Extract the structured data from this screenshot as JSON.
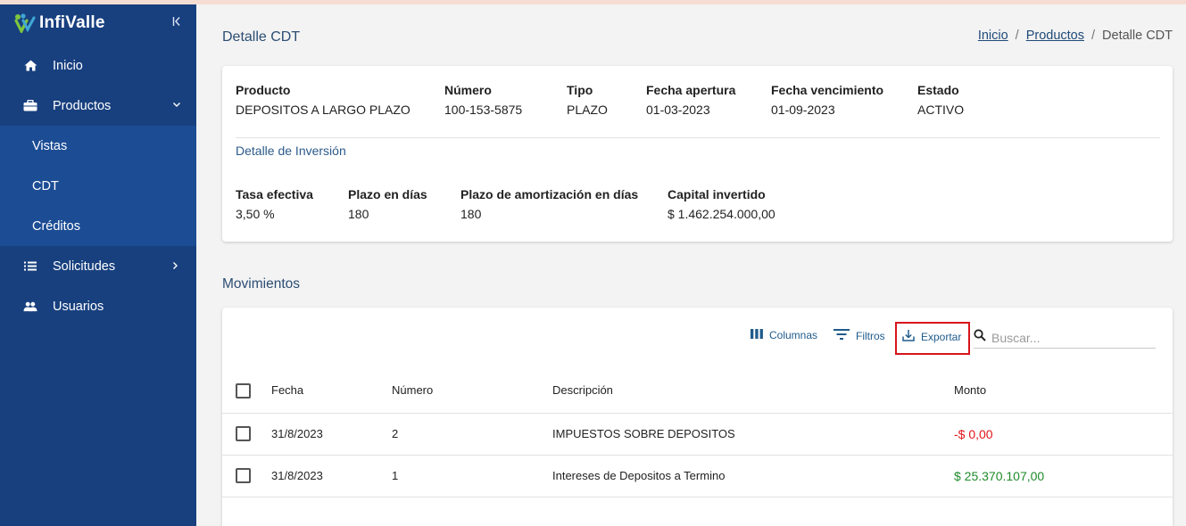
{
  "app": {
    "logo_text": "InfiValle",
    "collapse_icon": "collapse-left-icon"
  },
  "sidebar": {
    "items": [
      {
        "label": "Inicio",
        "icon": "home-icon"
      },
      {
        "label": "Productos",
        "icon": "briefcase-icon",
        "chevron": "⌄"
      },
      {
        "label": "Solicitudes",
        "icon": "list-icon",
        "chevron": "›"
      },
      {
        "label": "Usuarios",
        "icon": "users-icon"
      }
    ],
    "subitems": [
      {
        "label": "Vistas"
      },
      {
        "label": "CDT"
      },
      {
        "label": "Créditos"
      }
    ]
  },
  "page": {
    "title": "Detalle CDT",
    "breadcrumb": {
      "home": "Inicio",
      "products": "Productos",
      "current": "Detalle CDT",
      "separator": "/"
    }
  },
  "summary": {
    "fields": [
      {
        "label": "Producto",
        "value": "DEPOSITOS A LARGO PLAZO"
      },
      {
        "label": "Número",
        "value": "100-153-5875"
      },
      {
        "label": "Tipo",
        "value": "PLAZO"
      },
      {
        "label": "Fecha apertura",
        "value": "01-03-2023"
      },
      {
        "label": "Fecha vencimiento",
        "value": "01-09-2023"
      },
      {
        "label": "Estado",
        "value": "ACTIVO"
      }
    ],
    "section_title": "Detalle de Inversión",
    "investment": [
      {
        "label": "Tasa efectiva",
        "value": "3,50 %"
      },
      {
        "label": "Plazo en días",
        "value": "180"
      },
      {
        "label": "Plazo de amortización en días",
        "value": "180"
      },
      {
        "label": "Capital invertido",
        "value": "$ 1.462.254.000,00"
      }
    ]
  },
  "movements": {
    "title": "Movimientos",
    "toolbar": {
      "columns": "Columnas",
      "filters": "Filtros",
      "export": "Exportar",
      "search_placeholder": "Buscar..."
    },
    "columns": [
      "Fecha",
      "Número",
      "Descripción",
      "Monto"
    ],
    "rows": [
      {
        "fecha": "31/8/2023",
        "numero": "2",
        "descripcion": "IMPUESTOS SOBRE DEPOSITOS",
        "monto": "-$ 0,00"
      },
      {
        "fecha": "31/8/2023",
        "numero": "1",
        "descripcion": "Intereses de Depositos a Termino",
        "monto": "$ 25.370.107,00"
      }
    ]
  },
  "colors": {
    "sidebar": "#18407f",
    "submenu": "#1c4d94",
    "negative": "#e0141c",
    "positive": "#1f8a2a",
    "highlight": "#d8141c"
  }
}
